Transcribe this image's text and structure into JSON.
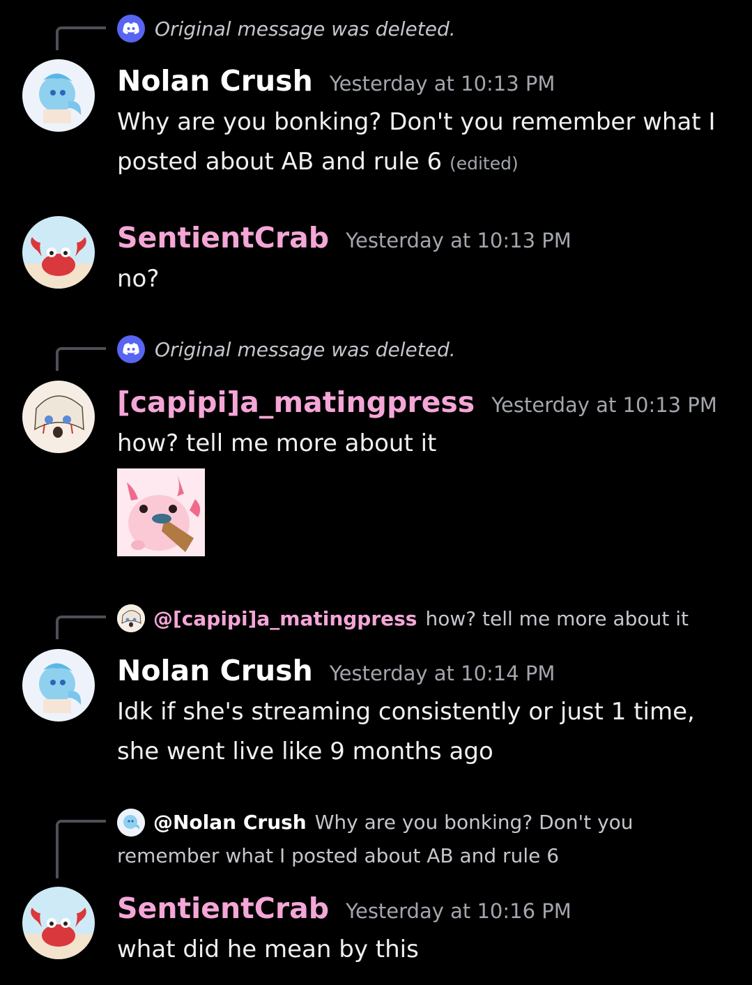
{
  "colors": {
    "background": "#000000",
    "nolan_name": "#ffffff",
    "crab_name": "#f4a6d7",
    "capipi_name": "#f4a6d7",
    "timestamp": "#a3a6ad",
    "reply_badge": "#5865f2"
  },
  "messages": [
    {
      "reply": {
        "type": "deleted",
        "icon": "discord-icon",
        "text": "Original message was deleted."
      },
      "author": "Nolan Crush",
      "timestamp": "Yesterday at 10:13 PM",
      "lines": [
        "Why are  you bonking? Don't you remember what I",
        "posted about AB and rule 6"
      ],
      "edited": "(edited)"
    },
    {
      "author": "SentientCrab",
      "timestamp": "Yesterday at 10:13 PM",
      "lines": [
        "no?"
      ]
    },
    {
      "reply": {
        "type": "deleted",
        "icon": "discord-icon",
        "text": "Original message was deleted."
      },
      "author": "[capipi]a_matingpress",
      "timestamp": "Yesterday at 10:13 PM",
      "lines": [
        "how? tell me more about it"
      ],
      "sticker": "axolotl-sticker"
    },
    {
      "reply": {
        "type": "mention",
        "mention": "@[capipi]a_matingpress",
        "text": "how? tell me more about it"
      },
      "author": "Nolan Crush",
      "timestamp": "Yesterday at 10:14 PM",
      "lines": [
        "Idk if she's streaming consistently or just 1 time,",
        "she went live like 9 months ago"
      ]
    },
    {
      "reply": {
        "type": "mention",
        "mention": "@Nolan Crush",
        "text_line1": "Why are  you bonking? Don't you",
        "text_line2": "remember what I posted about AB and rule 6"
      },
      "author": "SentientCrab",
      "timestamp": "Yesterday at 10:16 PM",
      "lines": [
        "what did he mean by this"
      ]
    }
  ]
}
